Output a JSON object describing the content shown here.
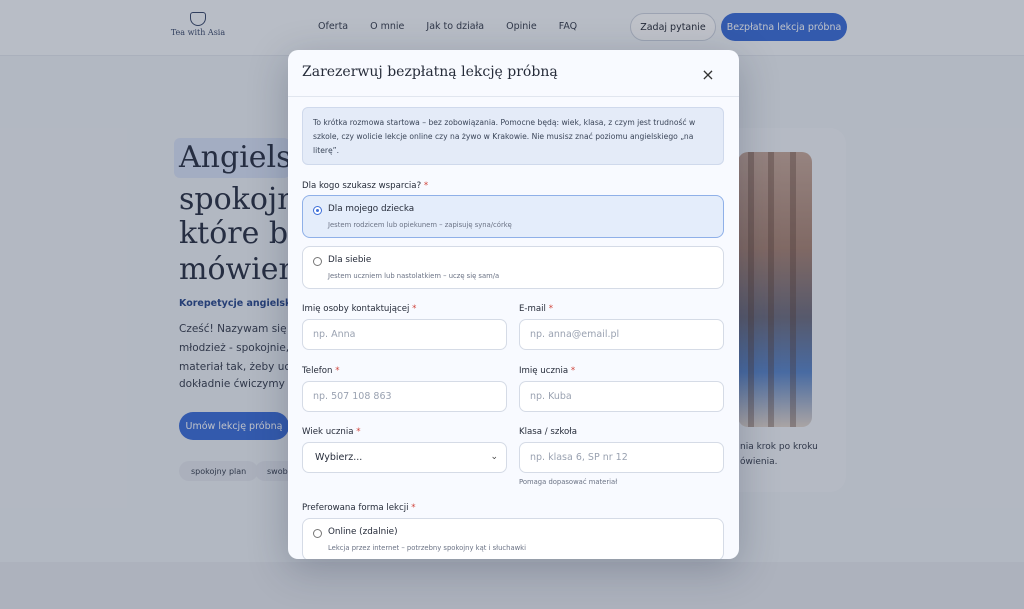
{
  "nav": {
    "logo_text": "Tea with Asia",
    "links": [
      "Oferta",
      "O mnie",
      "Jak to działa",
      "Opinie",
      "FAQ"
    ],
    "ask_button": "Zadaj pytanie",
    "trial_button": "Bezpłatna lekcja próbna"
  },
  "hero": {
    "line1": "Angielski",
    "line2": "spokojne",
    "line3": "które buc",
    "line4": "mówieniu",
    "subtitle": "Korepetycje angielskieg",
    "p1": "Cześć! Nazywam się A",
    "p2": "młodzież - spokojnie,",
    "p3": "materiał tak, żeby ucz",
    "p4": "dokładnie ćwiczymy p",
    "cta": "Umów lekcję próbną",
    "chips": [
      "spokojny plan",
      "swobo"
    ]
  },
  "side": {
    "text1": "nia krok po kroku",
    "text2": "ówienia."
  },
  "modal": {
    "title": "Zarezerwuj bezpłatną lekcję próbną",
    "close": "×",
    "info": "To krótka rozmowa startowa – bez zobowiązania. Pomocne będą: wiek, klasa, z czym jest trudność w szkole, czy wolicie lekcje online czy na żywo w Krakowie. Nie musisz znać poziomu angielskiego „na literę”.",
    "who_label": "Dla kogo szukasz wsparcia?",
    "options": [
      {
        "title": "Dla mojego dziecka",
        "desc": "Jestem rodzicem lub opiekunem – zapisuję syna/córkę",
        "selected": true
      },
      {
        "title": "Dla siebie",
        "desc": "Jestem uczniem lub nastolatkiem – uczę się sam/a",
        "selected": false
      }
    ],
    "required_mark": "*",
    "fields": {
      "contact_name": {
        "label": "Imię osoby kontaktującej",
        "placeholder": "np. Anna"
      },
      "email": {
        "label": "E-mail",
        "placeholder": "np. anna@email.pl"
      },
      "phone": {
        "label": "Telefon",
        "placeholder": "np. 507 108 863"
      },
      "student_name": {
        "label": "Imię ucznia",
        "placeholder": "np. Kuba"
      },
      "age": {
        "label": "Wiek ucznia",
        "value": "Wybierz..."
      },
      "school": {
        "label": "Klasa / szkoła",
        "placeholder": "np. klasa 6, SP nr 12",
        "hint": "Pomaga dopasować materiał"
      }
    },
    "form_label": "Preferowana forma lekcji",
    "form_options": [
      {
        "title": "Online (zdalnie)",
        "desc": "Lekcja przez internet – potrzebny spokojny kąt i słuchawki"
      }
    ]
  }
}
